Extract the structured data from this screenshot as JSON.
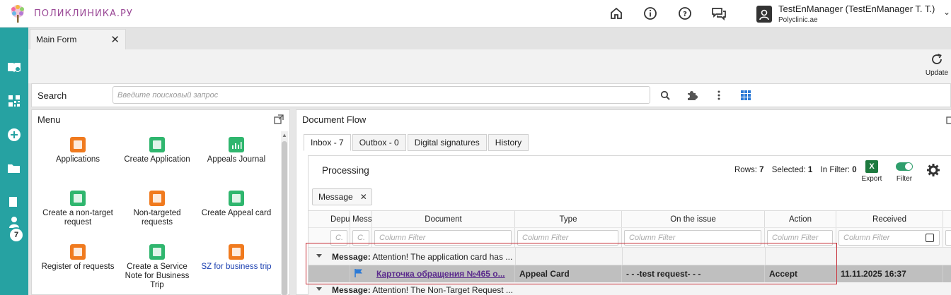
{
  "app": {
    "logo_text": "ПОЛИКЛИНИКА.РУ",
    "user_name": "TestEnManager (TestEnManager T. T.)",
    "user_org": "Polyclinic.ae"
  },
  "rail": {
    "badge_count": "7"
  },
  "tabs": {
    "main_tab": "Main Form"
  },
  "toolbar": {
    "update_label": "Update"
  },
  "search": {
    "label": "Search",
    "placeholder": "Введите поисковый запрос"
  },
  "menu": {
    "title": "Menu",
    "items": [
      {
        "label": "Applications",
        "icon": "orange-doc-icon"
      },
      {
        "label": "Create Application",
        "icon": "green-edit-icon"
      },
      {
        "label": "Appeals Journal",
        "icon": "chart-icon"
      },
      {
        "label": "Create a non-target request",
        "icon": "green-edit-icon"
      },
      {
        "label": "Non-targeted requests",
        "icon": "orange-doc-icon"
      },
      {
        "label": "Create Appeal card",
        "icon": "green-edit-icon"
      },
      {
        "label": "Register of requests",
        "icon": "orange-doc-icon"
      },
      {
        "label": "Create a Service Note for Business Trip",
        "icon": "green-edit-icon"
      },
      {
        "label": "SZ for business trip",
        "icon": "orange-doc-icon"
      }
    ]
  },
  "docflow": {
    "title": "Document Flow",
    "tabs": [
      "Inbox - 7",
      "Outbox - 0",
      "Digital signatures",
      "History"
    ],
    "processing": "Processing",
    "stats": {
      "rows_label": "Rows:",
      "rows": "7",
      "selected_label": "Selected:",
      "selected": "1",
      "filter_label": "In Filter:",
      "filter": "0"
    },
    "export_label": "Export",
    "export_glyph": "X",
    "filter_label": "Filter",
    "chip": "Message",
    "columns": [
      "Depu",
      "Mess",
      "Document",
      "Type",
      "On the issue",
      "Action",
      "Received"
    ],
    "filter_short": "C.",
    "filter_placeholder": "Column Filter",
    "group1": {
      "label": "Message:",
      "text": "Attention! The application card has ..."
    },
    "row": {
      "document": "Карточка обращения №465 о...",
      "type": "Appeal Card",
      "issue": "- - -test request- - -",
      "action": "Accept",
      "received": "11.11.2025 16:37"
    },
    "group2": {
      "label": "Message:",
      "text": "Attention! The Non-Target Request ..."
    }
  },
  "colors": {
    "rail": "#26a2a2",
    "highlight": "#c62d36",
    "link": "#5b2b8c"
  }
}
